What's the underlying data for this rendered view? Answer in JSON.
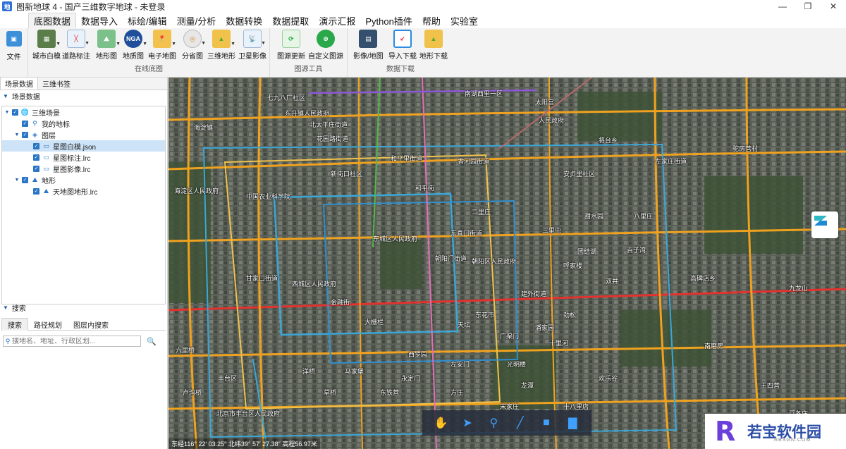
{
  "window": {
    "app_icon": "地",
    "title": "图新地球 4 - 国产三维数字地球 - 未登录",
    "controls": [
      "—",
      "❐",
      "✕"
    ]
  },
  "menu": {
    "tabs": [
      "底图数据",
      "数据导入",
      "标绘/编辑",
      "测量/分析",
      "数据转换",
      "数据提取",
      "演示汇报",
      "Python插件",
      "帮助",
      "实验室"
    ],
    "active": "底图数据"
  },
  "ribbon": {
    "file_label": "文件",
    "groups": [
      {
        "label": "在线底图",
        "buttons": [
          "城市白模",
          "道路标注",
          "地形图",
          "地质图",
          "电子地图",
          "分省图",
          "三维地形",
          "卫星影像"
        ]
      },
      {
        "label": "图源工具",
        "buttons": [
          "图源更新",
          "自定义图源"
        ]
      },
      {
        "label": "数据下载",
        "buttons": [
          "影像/地图",
          "导入下载",
          "地形下载"
        ]
      }
    ]
  },
  "left_panel": {
    "tabs": [
      "场景数据",
      "三维书签"
    ],
    "section_title": "场景数据",
    "tree": [
      {
        "label": "三维场景",
        "level": 0,
        "icon": "globe-icon",
        "expanded": true
      },
      {
        "label": "我的地标",
        "level": 1,
        "icon": "pin-icon"
      },
      {
        "label": "图层",
        "level": 1,
        "icon": "layers-icon",
        "expanded": true
      },
      {
        "label": "星图白模.json",
        "level": 2,
        "icon": "monitor-icon",
        "selected": true
      },
      {
        "label": "星图标注.lrc",
        "level": 2,
        "icon": "monitor-icon"
      },
      {
        "label": "星图影像.lrc",
        "level": 2,
        "icon": "monitor-icon"
      },
      {
        "label": "地形",
        "level": 1,
        "icon": "terrain-icon",
        "expanded": true
      },
      {
        "label": "天地图地形.lrc",
        "level": 2,
        "icon": "terrain-icon"
      }
    ],
    "search": {
      "title": "搜索",
      "tabs": [
        "搜索",
        "路径规划",
        "图层内搜索"
      ],
      "placeholder": "搜地名、地址、行政区划..."
    }
  },
  "map": {
    "labels": [
      "七九八厂社区",
      "南湖西里一区",
      "太阳宫",
      "海淀镇",
      "东升镇人民政府",
      "北太平庄街道",
      "人民政府",
      "将台乡",
      "花园路街道",
      "和平里街道",
      "香河园街道",
      "左家庄街道",
      "安贞里社区",
      "驼房营村",
      "海淀区人民政府",
      "中国农业科学院",
      "新街口社区",
      "二里庄",
      "东直门街道",
      "三里屯",
      "朝阳区人民政府",
      "西城区人民政府",
      "东城区人民政府",
      "甘家口街道",
      "朝阳门街道",
      "金融街",
      "大栅栏",
      "天坛",
      "东花市",
      "南磨房",
      "甜水园",
      "双井",
      "九龙山",
      "高碑店乡",
      "西罗园",
      "丰台区",
      "北京市丰台区人民政府",
      "六里桥",
      "卢沟桥",
      "欢乐谷",
      "草桥",
      "劲松",
      "百子湾",
      "团结湖",
      "和平街",
      "左安门",
      "光明楼",
      "东铁营",
      "马家堡",
      "洋桥",
      "方庄",
      "宋家庄",
      "十里河",
      "潘家园",
      "王四营",
      "十八里店",
      "豆各庄",
      "八里庄",
      "呼家楼",
      "建外街道",
      "广渠门",
      "龙潭",
      "永定门"
    ],
    "status": "东经116° 22′ 03.25″ 北纬39° 57′ 27.38″ 高程56.97米",
    "toolbar": [
      "hand-icon",
      "pointer-icon",
      "pin-icon",
      "line-icon",
      "rectangle-icon",
      "chart-icon"
    ]
  },
  "watermark": {
    "logo": "R",
    "text": "若宝软件园",
    "sub": "RBSGN.COM"
  }
}
